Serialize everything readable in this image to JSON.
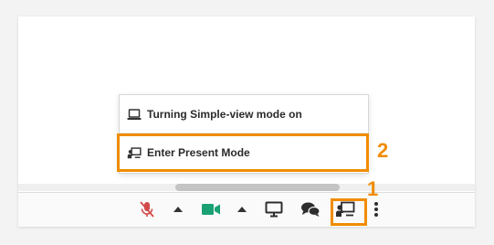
{
  "menu": {
    "items": [
      {
        "label": "Turning Simple-view mode on",
        "icon": "laptop-icon"
      },
      {
        "label": "Enter Present Mode",
        "icon": "present-mode-icon"
      }
    ]
  },
  "toolbar": {
    "buttons": [
      {
        "name": "microphone-muted",
        "icon": "mic-off-icon",
        "color": "#d24a4a"
      },
      {
        "name": "audio-options",
        "icon": "caret-up-icon"
      },
      {
        "name": "camera",
        "icon": "video-camera-icon",
        "color": "#19a174"
      },
      {
        "name": "video-options",
        "icon": "caret-up-icon"
      },
      {
        "name": "screen-share",
        "icon": "monitor-icon"
      },
      {
        "name": "chat",
        "icon": "chat-bubbles-icon"
      },
      {
        "name": "present-mode",
        "icon": "present-mode-icon"
      },
      {
        "name": "more-options",
        "icon": "more-vertical-icon"
      }
    ]
  },
  "annotations": {
    "one": "1",
    "two": "2",
    "color": "#f08c00"
  }
}
